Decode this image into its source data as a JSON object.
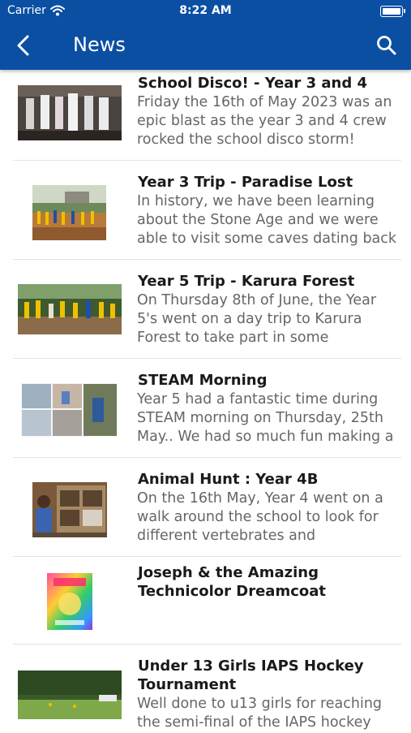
{
  "status": {
    "carrier": "Carrier",
    "time": "8:22 AM"
  },
  "nav": {
    "title": "News"
  },
  "icons": {
    "back": "chevron-left-icon",
    "search": "search-icon",
    "wifi": "wifi-icon",
    "battery": "battery-icon"
  },
  "colors": {
    "header": "#0b4fa3",
    "title_text": "#1a1a1a",
    "snippet_text": "#666666"
  },
  "articles": [
    {
      "title": "School Disco! - Year 3 and 4",
      "lines": [
        "Friday the 16th of May 2023 was an",
        "epic blast as the year 3 and 4 crew",
        "rocked the school disco storm!"
      ]
    },
    {
      "title": "Year 3 Trip - Paradise Lost",
      "lines": [
        "In history, we have been learning",
        "about the Stone Age and we were",
        "able to visit some caves dating back"
      ]
    },
    {
      "title": "Year 5 Trip - Karura Forest",
      "lines": [
        "On Thursday 8th of June, the Year",
        "5's went on a day trip to Karura",
        "Forest to take part in some"
      ]
    },
    {
      "title": "STEAM Morning",
      "lines": [
        "Year 5 had a fantastic time during",
        "STEAM morning on Thursday, 25th",
        "May.. We had so much fun making a"
      ]
    },
    {
      "title": "Animal Hunt : Year 4B",
      "lines": [
        "On the 16th May, Year 4 went on a",
        "walk around the school to look for",
        "different vertebrates and"
      ]
    },
    {
      "title_lines": [
        "Joseph & the Amazing",
        "Technicolor Dreamcoat"
      ]
    },
    {
      "title_lines": [
        "Under 13 Girls IAPS Hockey",
        "Tournament"
      ],
      "lines": [
        "Well done to u13 girls for reaching",
        "the semi-final of the IAPS hockey"
      ]
    }
  ]
}
